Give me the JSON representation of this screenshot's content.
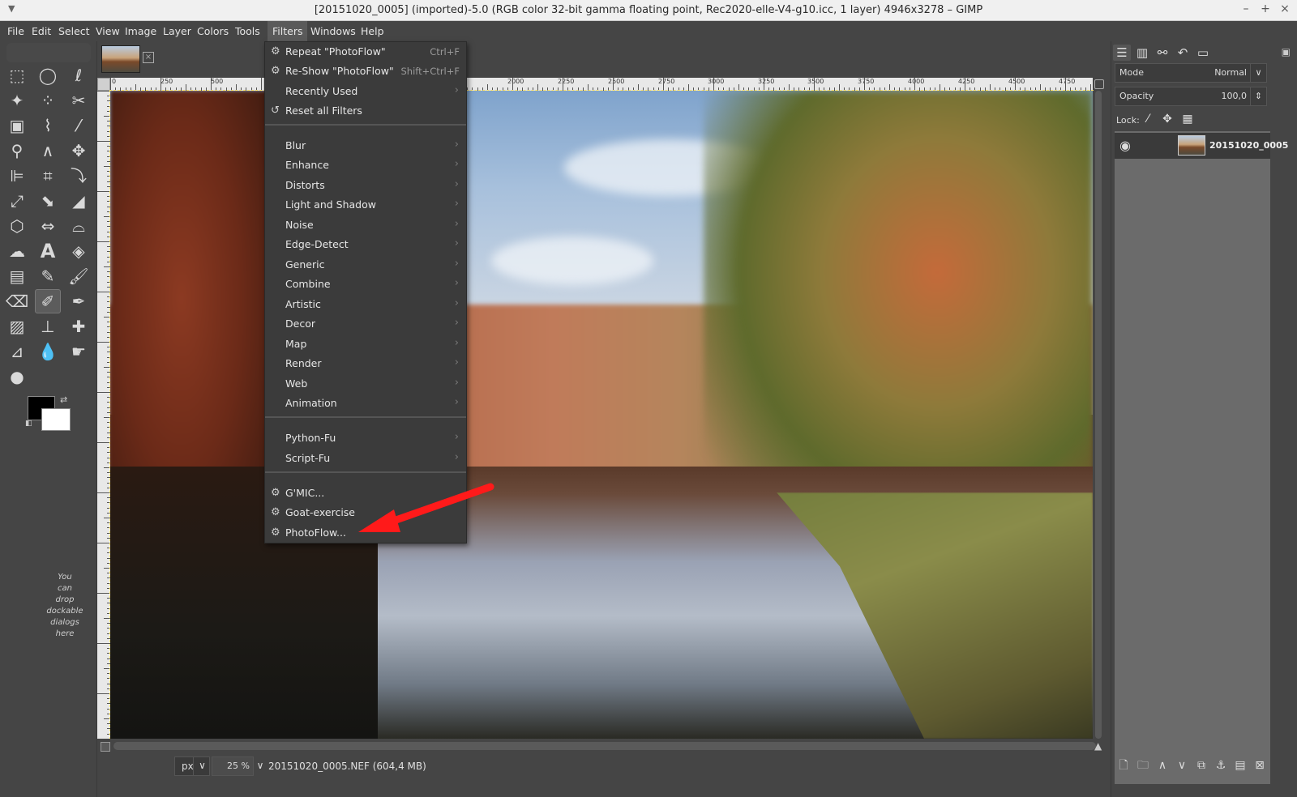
{
  "window": {
    "title": "[20151020_0005] (imported)-5.0 (RGB color 32-bit gamma floating point, Rec2020-elle-V4-g10.icc, 1 layer) 4946x3278 – GIMP",
    "minimize": "–",
    "maximize": "+",
    "close": "×"
  },
  "menubar": [
    "File",
    "Edit",
    "Select",
    "View",
    "Image",
    "Layer",
    "Colors",
    "Tools",
    "Filters",
    "Windows",
    "Help"
  ],
  "filters_menu": {
    "top_items": [
      {
        "label": "Repeat \"PhotoFlow\"",
        "accel": "Ctrl+F",
        "icon": "plugin-icon"
      },
      {
        "label": "Re-Show \"PhotoFlow\"",
        "accel": "Shift+Ctrl+F",
        "icon": "plugin-icon"
      },
      {
        "label": "Recently Used",
        "accel": "",
        "icon": ""
      },
      {
        "label": "Reset all Filters",
        "accel": "",
        "icon": "reset-icon"
      }
    ],
    "categories": [
      "Blur",
      "Enhance",
      "Distorts",
      "Light and Shadow",
      "Noise",
      "Edge-Detect",
      "Generic",
      "Combine",
      "Artistic",
      "Decor",
      "Map",
      "Render",
      "Web",
      "Animation"
    ],
    "script_items": [
      "Python-Fu",
      "Script-Fu"
    ],
    "plugins": [
      "G'MIC...",
      "Goat-exercise",
      "PhotoFlow..."
    ]
  },
  "ruler": {
    "top_labels": [
      "0",
      "250",
      "500",
      "2000",
      "2250",
      "2500",
      "2750",
      "3000",
      "3250",
      "3500",
      "3750",
      "4000",
      "4250",
      "4500",
      "4750"
    ]
  },
  "toolbox": {
    "drop_hint": "You\ncan\ndrop\ndockable\ndialogs\nhere"
  },
  "statusbar": {
    "unit": "px",
    "zoom": "25 %",
    "file_info": "20151020_0005.NEF (604,4 MB)"
  },
  "layers_dock": {
    "mode_label": "Mode",
    "mode_value": "Normal",
    "opacity_label": "Opacity",
    "opacity_value": "100,0",
    "lock_label": "Lock:",
    "layer_name": "20151020_0005"
  },
  "colors": {
    "annotation_arrow": "#ff1a1a",
    "foreground": "#000000",
    "background": "#ffffff"
  }
}
